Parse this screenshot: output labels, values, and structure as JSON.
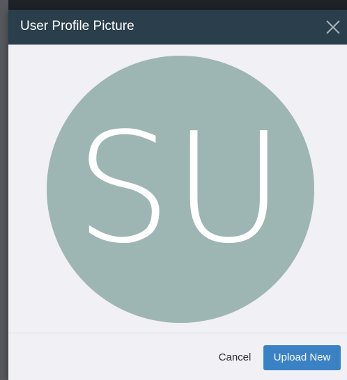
{
  "dialog": {
    "title": "User Profile Picture",
    "close_icon": "close-icon"
  },
  "avatar": {
    "initials": "SU",
    "background_color": "#9eb6b3",
    "text_color": "#ffffff"
  },
  "footer": {
    "cancel_label": "Cancel",
    "upload_label": "Upload New"
  },
  "colors": {
    "header": "#2a3e4c",
    "dialog_body": "#f1f0f5",
    "primary_button": "#3b82c4"
  }
}
